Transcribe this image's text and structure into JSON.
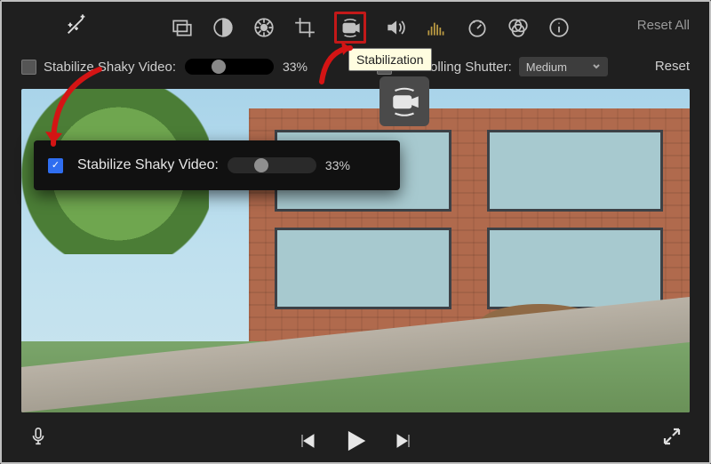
{
  "toolbar": {
    "reset_all_label": "Reset All"
  },
  "tooltip": {
    "stabilization": "Stabilization"
  },
  "adjust": {
    "stabilize_label": "Stabilize Shaky Video:",
    "stabilize_checked": false,
    "stabilize_percent": "33%",
    "rolling_label": "Fix Rolling Shutter:",
    "rolling_value": "Medium",
    "reset_label": "Reset"
  },
  "popover": {
    "stabilize_label": "Stabilize Shaky Video:",
    "stabilize_checked": true,
    "stabilize_percent": "33%"
  },
  "icons": {
    "wand": "magic-wand-icon",
    "screen": "video-overlay-icon",
    "contrast": "color-balance-icon",
    "palette": "color-correction-icon",
    "crop": "crop-icon",
    "camera": "stabilization-icon",
    "volume": "volume-icon",
    "eq": "noise-eq-icon",
    "speed": "speed-icon",
    "filter": "clip-filter-icon",
    "info": "info-icon",
    "mic": "voiceover-icon",
    "prev": "previous-icon",
    "play": "play-icon",
    "next": "next-icon",
    "fullscreen": "fullscreen-icon"
  }
}
